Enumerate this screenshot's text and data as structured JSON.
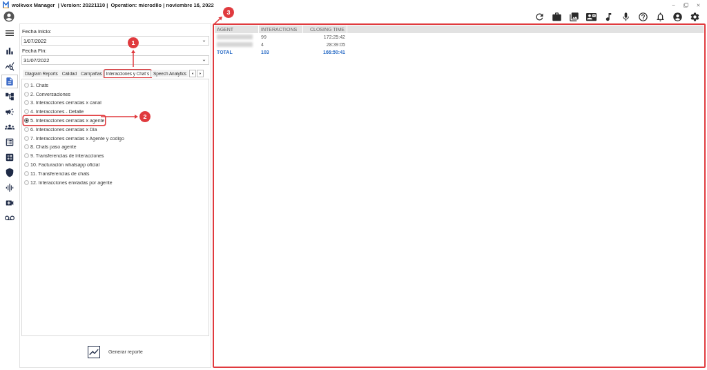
{
  "window": {
    "title": "wolkvox Manager  | Version: 20221110 |  Operation: microdllo | noviembre 16, 2022"
  },
  "sidebar": {
    "items": [
      {
        "selected": false
      },
      {
        "selected": false
      },
      {
        "selected": true
      },
      {
        "selected": false
      },
      {
        "selected": false
      },
      {
        "selected": false
      },
      {
        "selected": false
      },
      {
        "selected": false
      },
      {
        "selected": false
      },
      {
        "selected": false
      },
      {
        "selected": false
      },
      {
        "selected": false
      }
    ]
  },
  "filters": [
    {
      "label": "Fecha Inicio:",
      "value": "1/07/2022"
    },
    {
      "label": "Fecha Fin:",
      "value": "31/07/2022"
    }
  ],
  "tabs": [
    {
      "label": "Diagram Reports",
      "selected": false,
      "highlighted": false
    },
    {
      "label": "Calidad",
      "selected": false,
      "highlighted": false
    },
    {
      "label": "Campañas",
      "selected": false,
      "highlighted": false
    },
    {
      "label": "Interacciones y Chat´s",
      "selected": true,
      "highlighted": true
    },
    {
      "label": "Speech Analytics",
      "selected": false,
      "highlighted": false
    }
  ],
  "reports": [
    {
      "label": "1. Chats",
      "selected": false,
      "highlighted": false
    },
    {
      "label": "2. Conversaciones",
      "selected": false,
      "highlighted": false
    },
    {
      "label": "3. Interacciones cerradas x canal",
      "selected": false,
      "highlighted": false
    },
    {
      "label": "4. Interacciones - Detalle",
      "selected": false,
      "highlighted": false
    },
    {
      "label": "5. Interacciones cerradas x agente",
      "selected": true,
      "highlighted": true
    },
    {
      "label": "6. Interacciones cerradas x Dia",
      "selected": false,
      "highlighted": false
    },
    {
      "label": "7. Interacciones cerradas x Agente y codigo",
      "selected": false,
      "highlighted": false
    },
    {
      "label": "8. Chats paso agente",
      "selected": false,
      "highlighted": false
    },
    {
      "label": "9. Transferencias de interacciones",
      "selected": false,
      "highlighted": false
    },
    {
      "label": "10. Facturación whatsapp oficial",
      "selected": false,
      "highlighted": false
    },
    {
      "label": "11. Transferencias de chats",
      "selected": false,
      "highlighted": false
    },
    {
      "label": "12. Interacciones enviadas por agente",
      "selected": false,
      "highlighted": false
    }
  ],
  "generate_button": {
    "label": "Generar reporte"
  },
  "table": {
    "highlighted": true,
    "columns": [
      "AGENT",
      "INTERACTIONS",
      "CLOSING TIME"
    ],
    "rows": [
      {
        "agent_redacted": true,
        "interactions": "99",
        "closing_time": "172:25:42"
      },
      {
        "agent_redacted": true,
        "interactions": "4",
        "closing_time": "28:39:05"
      }
    ],
    "total": {
      "label": "TOTAL",
      "interactions": "103",
      "closing_time": "166:50:41"
    }
  },
  "callouts": [
    {
      "number": "1"
    },
    {
      "number": "2"
    },
    {
      "number": "3"
    }
  ]
}
